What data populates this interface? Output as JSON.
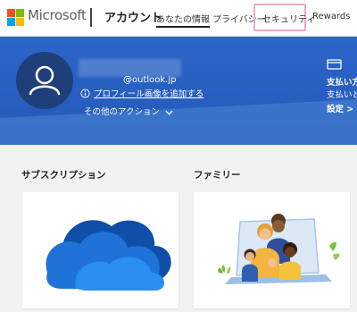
{
  "header": {
    "brand": "Microsoft",
    "site_title": "アカウント",
    "nav": [
      {
        "label": "あなたの情報"
      },
      {
        "label": "プライバシー"
      },
      {
        "label": "セキュリティ"
      },
      {
        "label": "Rewards"
      }
    ],
    "logo_colors": [
      "#f25022",
      "#7fba00",
      "#00a4ef",
      "#ffb900"
    ]
  },
  "profile": {
    "email_suffix": "@outlook.jp",
    "add_photo_label": "プロフィール画像を追加する",
    "other_actions_label": "その他のアクション"
  },
  "payment": {
    "title": "支払い方",
    "subtitle": "支払いと",
    "settings": "設定 >"
  },
  "sections": {
    "subscriptions_title": "サブスクリプション",
    "family_title": "ファミリー"
  },
  "colors": {
    "hero_blue": "#2b66c8",
    "avatar_bg": "#1f3f7a",
    "security_highlight": "#f0a7c9"
  }
}
